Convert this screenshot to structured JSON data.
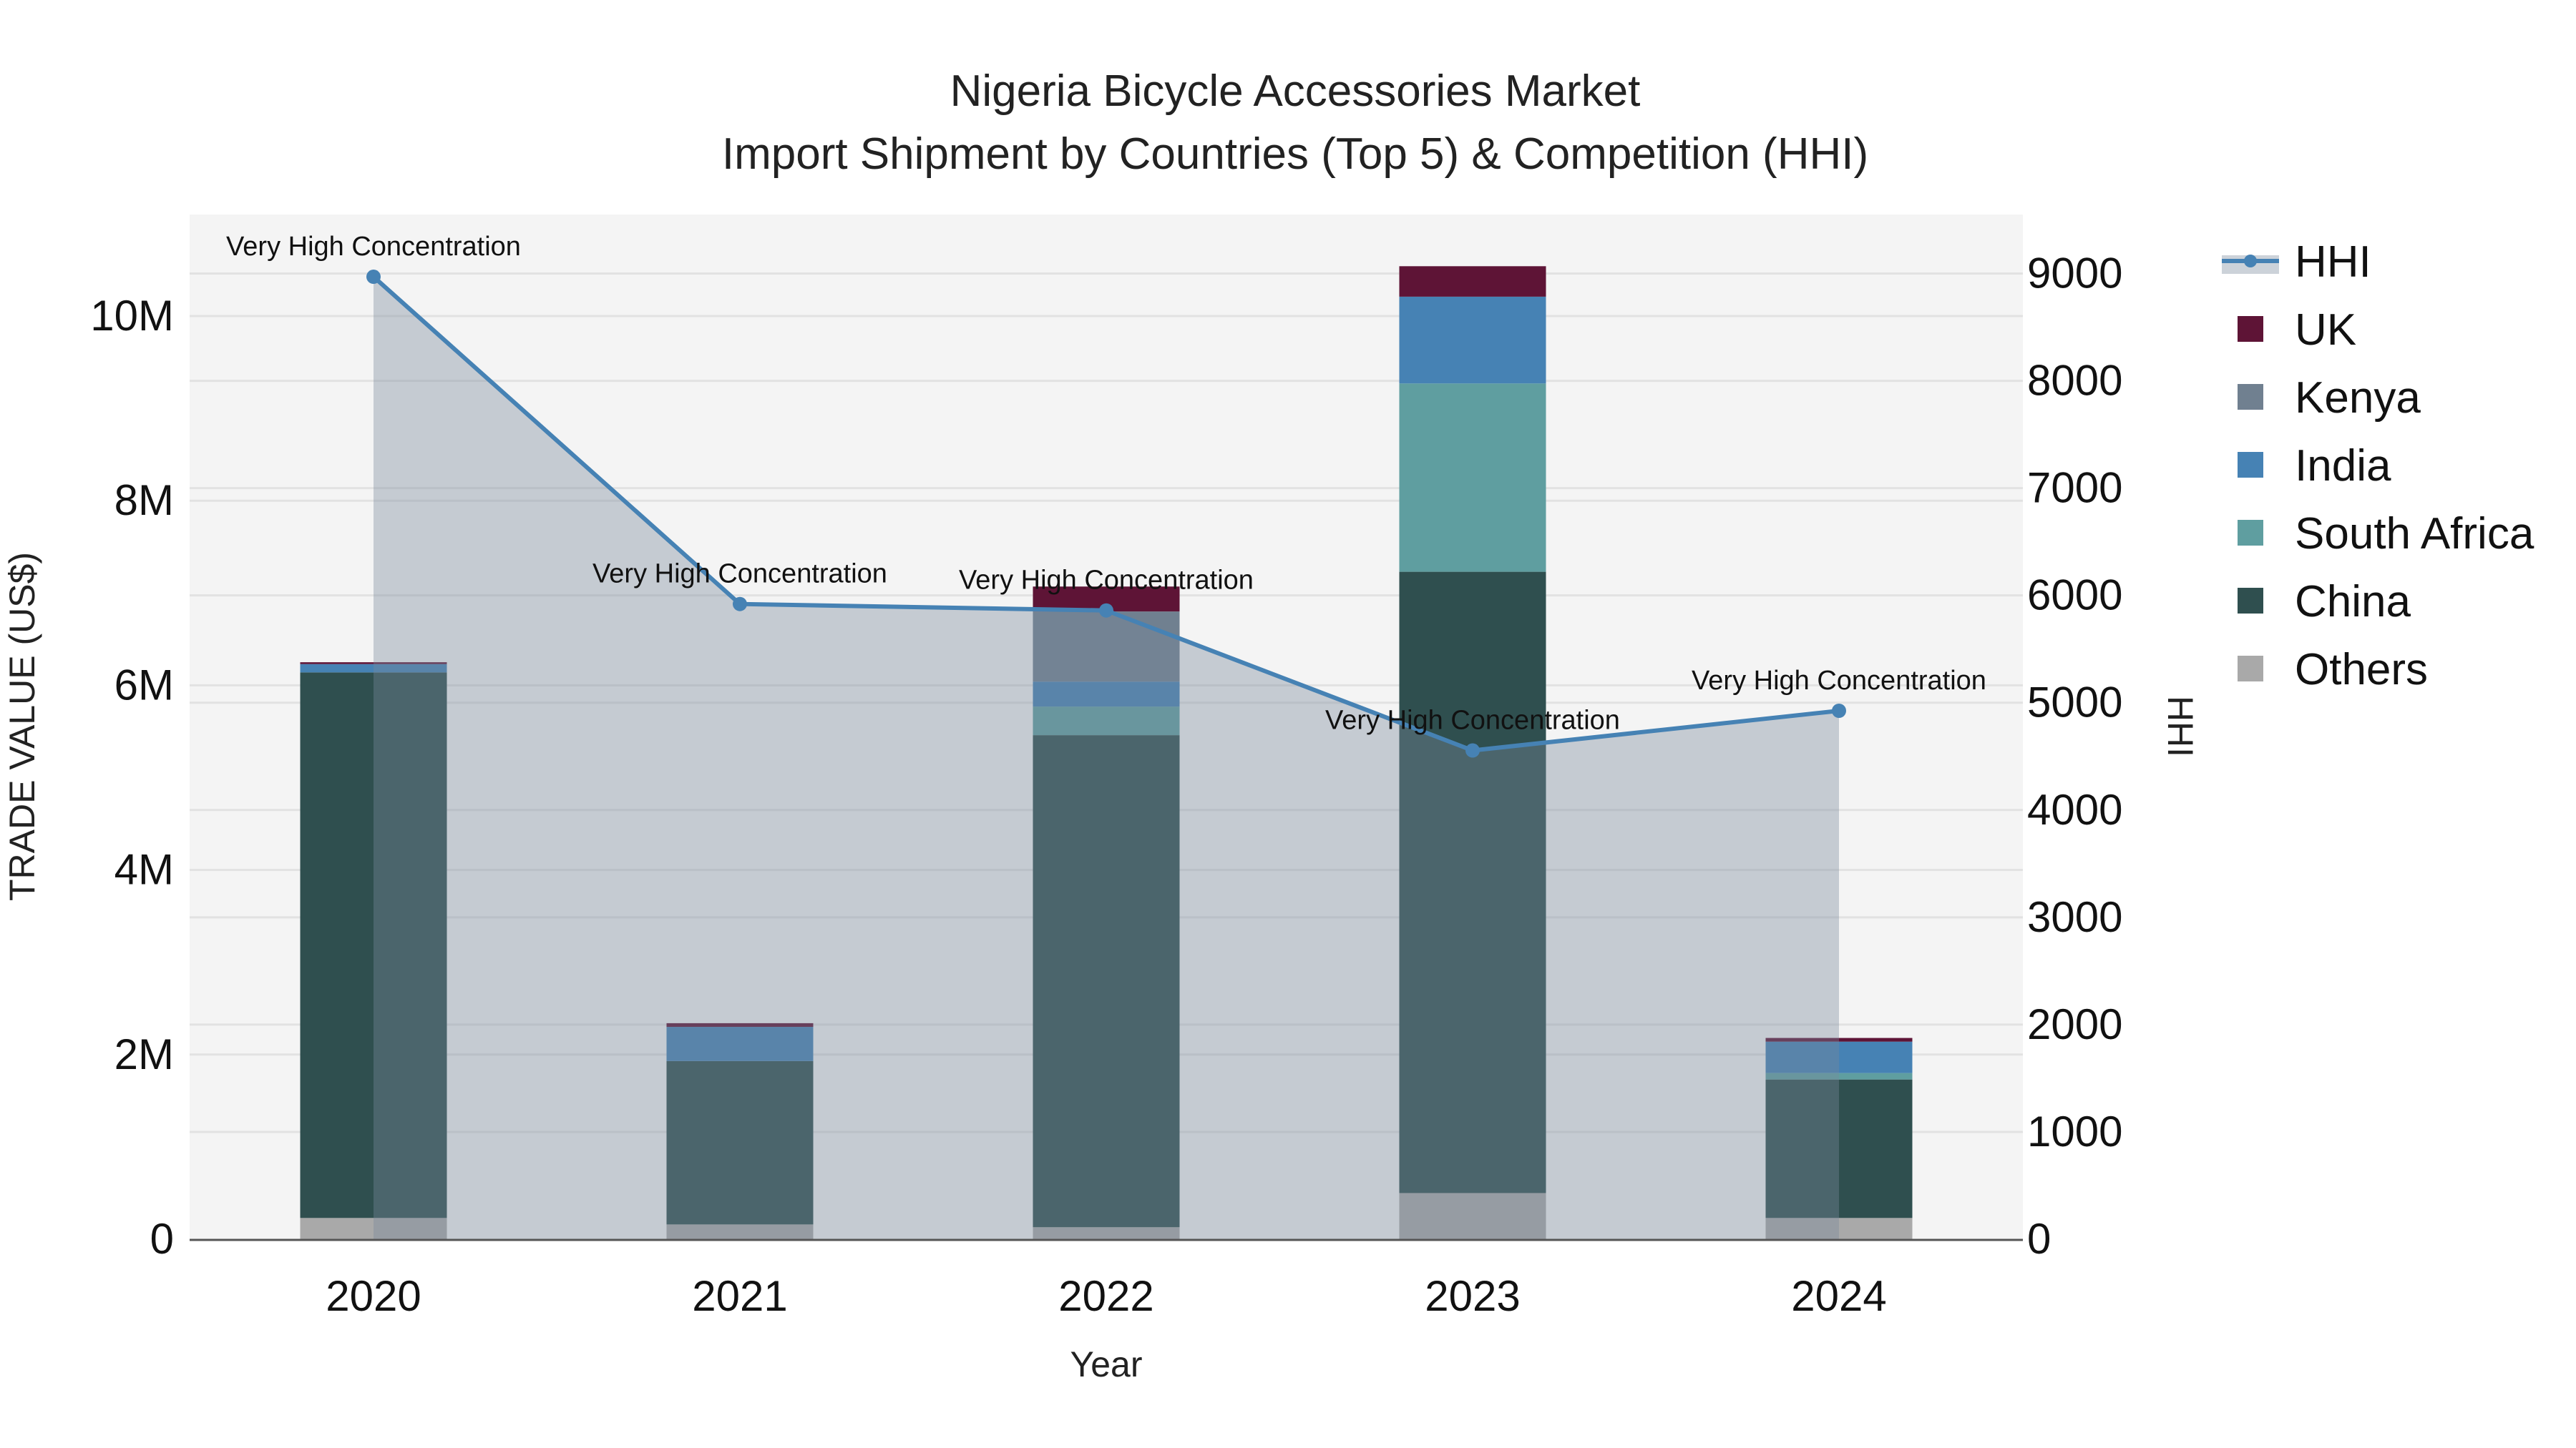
{
  "chart_data": {
    "type": "bar",
    "title": "Nigeria Bicycle Accessories Market",
    "subtitle": "Import Shipment by Countries (Top 5) & Competition (HHI)",
    "xlabel": "Year",
    "ylabel": "TRADE VALUE (US$)",
    "y2label": "HHI",
    "categories": [
      "2020",
      "2021",
      "2022",
      "2023",
      "2024"
    ],
    "ylim": [
      0,
      11100000
    ],
    "y2lim": [
      0,
      9550
    ],
    "yticks": [
      0,
      2000000,
      4000000,
      6000000,
      8000000,
      10000000
    ],
    "ytick_labels": [
      "0",
      "2M",
      "4M",
      "6M",
      "8M",
      "10M"
    ],
    "y2ticks": [
      0,
      1000,
      2000,
      3000,
      4000,
      5000,
      6000,
      7000,
      8000,
      9000
    ],
    "y2tick_labels": [
      "0",
      "1000",
      "2000",
      "3000",
      "4000",
      "5000",
      "6000",
      "7000",
      "8000",
      "9000"
    ],
    "stacked": true,
    "series": [
      {
        "name": "Others",
        "color": "#a9a9a9",
        "values": [
          230000,
          160000,
          130000,
          500000,
          230000
        ]
      },
      {
        "name": "China",
        "color": "#2f4f4f",
        "values": [
          5910000,
          1770000,
          5330000,
          6730000,
          1500000
        ]
      },
      {
        "name": "South Africa",
        "color": "#5f9ea0",
        "values": [
          0,
          0,
          310000,
          2040000,
          70000
        ]
      },
      {
        "name": "India",
        "color": "#4682b4",
        "values": [
          90000,
          370000,
          270000,
          940000,
          340000
        ]
      },
      {
        "name": "Kenya",
        "color": "#708090",
        "values": [
          0,
          0,
          760000,
          0,
          0
        ]
      },
      {
        "name": "UK",
        "color": "#5e1436",
        "values": [
          20000,
          40000,
          270000,
          330000,
          40000
        ]
      }
    ],
    "line": {
      "name": "HHI",
      "color": "#4682b4",
      "axis": "right",
      "values": [
        8970,
        5920,
        5860,
        4555,
        4925
      ],
      "annotations": [
        "Very High Concentration",
        "Very High Concentration",
        "Very High Concentration",
        "Very High Concentration",
        "Very High Concentration"
      ]
    },
    "legend": [
      "HHI",
      "UK",
      "Kenya",
      "India",
      "South Africa",
      "China",
      "Others"
    ],
    "legend_position": "right",
    "grid": true
  }
}
